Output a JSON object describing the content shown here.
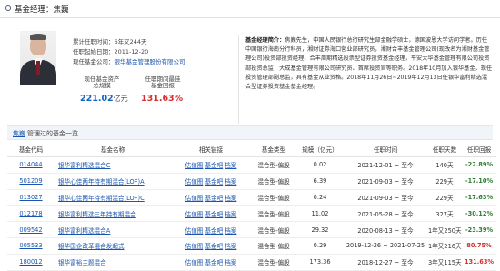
{
  "header": {
    "title": "基金经理：焦巍"
  },
  "manager": {
    "name": "焦巍",
    "tenure_label": "累计任职时间：",
    "tenure_value": "6年又244天",
    "start_label": "任职起始日期：",
    "start_value": "2011-12-20",
    "company_label": "现任基金公司：",
    "company_value": "银华基金管理股份有限公司",
    "assets_label_1": "现任基金资产",
    "assets_label_2": "总规模",
    "assets_value": "221.02",
    "assets_unit": "亿元",
    "return_label_1": "任职期间最佳",
    "return_label_2": "基金回报",
    "return_value": "131.63%"
  },
  "intro": {
    "label": "基金经理简介：",
    "text": "焦巍先生，中国人民银行总行研究生部金融学硕士，德国波恩大学访问学者。历任中国银行海南分行科员，湘财证券海口营业部研究员，湘财合丰基金管理公司(现改名为湘财基金管理公司)投资部投资经理、合丰周期精选股票型证券投资基金经理，平安大华基金管理有限公司投资部投资总监，大成基金管理有限公司研究员、首席投资官等职务。2018年10月加入银华基金，现任投资管理部副总监，具有基金从业资格。2018年11月26日~2019年12月13日任银华富利精选混合型证券投资基金基金经理。"
  },
  "history": {
    "name_link": "焦巍",
    "title_rest": "管理过的基金一览"
  },
  "table": {
    "headers": [
      "基金代码",
      "基金名称",
      "相关链接",
      "基金类型",
      "规模（亿元）",
      "任职时间",
      "任职天数",
      "任职回报"
    ],
    "link_labels": [
      "估值图",
      "基金吧",
      "档案"
    ],
    "rows": [
      {
        "code": "014044",
        "name": "银华富利精选混合C",
        "type": "混合型-偏股",
        "scale": "0.02",
        "period": "2021-12-01 ~ 至今",
        "days": "140天",
        "ret": "-22.89%",
        "ret_sign": "neg"
      },
      {
        "code": "501209",
        "name": "银华心佳两年持有期混合(LOF)A",
        "type": "混合型-偏股",
        "scale": "6.39",
        "period": "2021-09-03 ~ 至今",
        "days": "229天",
        "ret": "-17.10%",
        "ret_sign": "neg"
      },
      {
        "code": "013027",
        "name": "银华心佳两年持有期混合(LOF)C",
        "type": "混合型-偏股",
        "scale": "0.24",
        "period": "2021-09-03 ~ 至今",
        "days": "229天",
        "ret": "-17.63%",
        "ret_sign": "neg"
      },
      {
        "code": "012178",
        "name": "银华富利精选三年持有期混合",
        "type": "混合型-偏股",
        "scale": "11.02",
        "period": "2021-05-28 ~ 至今",
        "days": "327天",
        "ret": "-30.12%",
        "ret_sign": "neg"
      },
      {
        "code": "009542",
        "name": "银华富利精选混合A",
        "type": "混合型-偏股",
        "scale": "29.32",
        "period": "2020-08-13 ~ 至今",
        "days": "1年又250天",
        "ret": "-23.39%",
        "ret_sign": "neg"
      },
      {
        "code": "005533",
        "name": "银华国企改革混合发起式",
        "type": "混合型-偏股",
        "scale": "0.29",
        "period": "2019-12-26 ~ 2021-07-25",
        "days": "1年又216天",
        "ret": "80.75%",
        "ret_sign": "pos"
      },
      {
        "code": "180012",
        "name": "银华富裕主题混合",
        "type": "混合型-偏股",
        "scale": "173.36",
        "period": "2018-12-27 ~ 至今",
        "days": "3年又115天",
        "ret": "131.63%",
        "ret_sign": "pos"
      }
    ]
  },
  "colors": {
    "link": "#1a56b0",
    "positive": "#d32f2f",
    "negative": "#2e7d32",
    "value_blue": "#1565c0"
  }
}
